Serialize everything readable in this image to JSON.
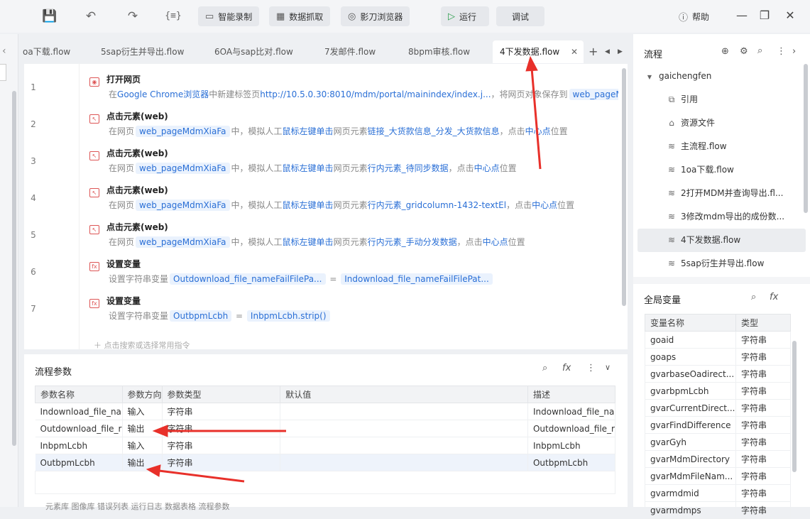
{
  "toolbar": {
    "smart_record": "智能录制",
    "data_capture": "数据抓取",
    "browser": "影刀浏览器",
    "run": "运行",
    "debug": "调试",
    "help": "帮助"
  },
  "tabs": [
    "oa下载.flow",
    "5sap衍生并导出.flow",
    "6OA与sap比对.flow",
    "7发邮件.flow",
    "8bpm审核.flow",
    "4下发数据.flow"
  ],
  "steps": [
    {
      "line": "1",
      "title": "打开网页",
      "desc": {
        "a": "在",
        "b": "Google Chrome浏览器",
        "c": "中新建标签页",
        "d": "http://10.5.0.30:8010/mdm/portal/mainindex/index.j...",
        "e": "，将网页对象保存到",
        "f": "web_pageMdm"
      }
    },
    {
      "line": "2",
      "title": "点击元素(web)",
      "desc": {
        "a": "在网页",
        "b": "web_pageMdmXiaFa",
        "c": "中，模拟人工",
        "d": "鼠标左键单击",
        "e": "网页元素",
        "f": "链接_大货款信息_分发_大货款信息",
        "g": "，点击",
        "h": "中心点",
        "i": "位置"
      }
    },
    {
      "line": "3",
      "title": "点击元素(web)",
      "desc": {
        "a": "在网页",
        "b": "web_pageMdmXiaFa",
        "c": "中，模拟人工",
        "d": "鼠标左键单击",
        "e": "网页元素",
        "f": "行内元素_待同步数据",
        "g": "，点击",
        "h": "中心点",
        "i": "位置"
      }
    },
    {
      "line": "4",
      "title": "点击元素(web)",
      "desc": {
        "a": "在网页",
        "b": "web_pageMdmXiaFa",
        "c": "中，模拟人工",
        "d": "鼠标左键单击",
        "e": "网页元素",
        "f": "行内元素_gridcolumn-1432-textEl",
        "g": "，点击",
        "h": "中心点",
        "i": "位置"
      }
    },
    {
      "line": "5",
      "title": "点击元素(web)",
      "desc": {
        "a": "在网页",
        "b": "web_pageMdmXiaFa",
        "c": "中，模拟人工",
        "d": "鼠标左键单击",
        "e": "网页元素",
        "f": "行内元素_手动分发数据",
        "g": "，点击",
        "h": "中心点",
        "i": "位置"
      }
    },
    {
      "line": "6",
      "title": "设置变量",
      "desc": {
        "a": "设置字符串变量",
        "b": "Outdownload_file_nameFailFilePa...",
        "c": "=",
        "d": "Indownload_file_nameFailFilePat..."
      }
    },
    {
      "line": "7",
      "title": "设置变量",
      "desc": {
        "a": "设置字符串变量",
        "b": "OutbpmLcbh",
        "c": "=",
        "d": "InbpmLcbh.strip()"
      }
    }
  ],
  "add_command": "点击搜索或选择常用指令",
  "params": {
    "title": "流程参数",
    "headers": [
      "参数名称",
      "参数方向",
      "参数类型",
      "默认值",
      "描述"
    ],
    "rows": [
      [
        "Indownload_file_na",
        "输入",
        "字符串",
        "",
        "Indownload_file_na"
      ],
      [
        "Outdownload_file_r",
        "输出",
        "字符串",
        "",
        "Outdownload_file_r"
      ],
      [
        "InbpmLcbh",
        "输入",
        "字符串",
        "",
        "InbpmLcbh"
      ],
      [
        "OutbpmLcbh",
        "输出",
        "字符串",
        "",
        "OutbpmLcbh"
      ]
    ],
    "bottom_tabs": "元素库    图像库    错误列表    运行日志    数据表格    流程参数"
  },
  "flow_panel": {
    "title": "流程",
    "root": "gaichengfen",
    "items": [
      "引用",
      "资源文件",
      "主流程.flow",
      "1oa下载.flow",
      "2打开MDM并查询导出.fl...",
      "3修改mdm导出的成份数...",
      "4下发数据.flow",
      "5sap衍生并导出.flow"
    ],
    "selected_index": 6
  },
  "globals": {
    "title": "全局变量",
    "headers": [
      "变量名称",
      "类型"
    ],
    "rows": [
      [
        "goaid",
        "字符串"
      ],
      [
        "goaps",
        "字符串"
      ],
      [
        "gvarbaseOadirect...",
        "字符串"
      ],
      [
        "gvarbpmLcbh",
        "字符串"
      ],
      [
        "gvarCurrentDirect...",
        "字符串"
      ],
      [
        "gvarFindDifference",
        "字符串"
      ],
      [
        "gvarGyh",
        "字符串"
      ],
      [
        "gvarMdmDirectory",
        "字符串"
      ],
      [
        "gvarMdmFileNam...",
        "字符串"
      ],
      [
        "gvarmdmid",
        "字符串"
      ],
      [
        "gvarmdmps",
        "字符串"
      ]
    ]
  },
  "colors": {
    "accent": "#2a6fd6",
    "arrow": "#e8302a"
  }
}
